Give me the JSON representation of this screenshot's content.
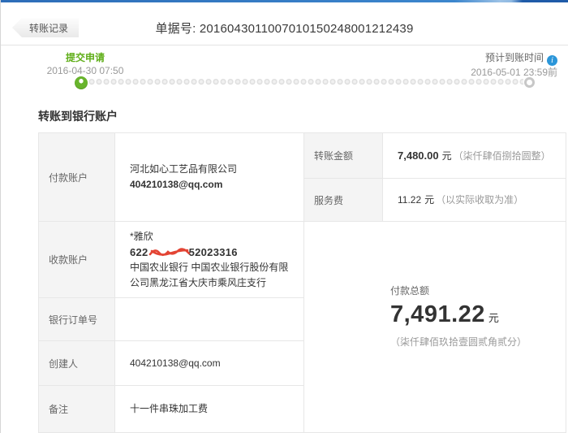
{
  "header": {
    "back_label": "转账记录",
    "doc_label": "单据号: ",
    "doc_number": "2016043011007010150248001212439"
  },
  "timeline": {
    "start": {
      "title": "提交申请",
      "time": "2016-04-30 07:50"
    },
    "end": {
      "title": "预计到账时间",
      "time": "2016-05-01 23:59前",
      "info_glyph": "i"
    }
  },
  "section": {
    "title": "转账到银行账户"
  },
  "fields": {
    "payer": {
      "label": "付款账户",
      "company": "河北如心工艺品有限公司",
      "account": "404210138@qq.com"
    },
    "payee": {
      "label": "收款账户",
      "name": "*雅欣",
      "card_prefix": "622",
      "card_suffix": "52023316",
      "bank": "中国农业银行 中国农业银行股份有限公司黑龙江省大庆市乘风庄支行"
    },
    "bank_order": {
      "label": "银行订单号",
      "value": ""
    },
    "creator": {
      "label": "创建人",
      "value": "404210138@qq.com"
    },
    "remark": {
      "label": "备注",
      "value": "十一件串珠加工费"
    }
  },
  "amounts": {
    "transfer": {
      "label": "转账金额",
      "value": "7,480.00",
      "unit": "元",
      "caps": "（柒仟肆佰捌拾圆整）"
    },
    "fee": {
      "label": "服务费",
      "value": "11.22",
      "unit": "元",
      "note": "（以实际收取为准）"
    },
    "total": {
      "label": "付款总额",
      "value": "7,491.22",
      "unit": "元",
      "caps": "（柒仟肆佰玖拾壹圆贰角贰分）"
    }
  },
  "colors": {
    "accent_green": "#5fae18",
    "info_blue": "#2b96d9",
    "scribble_red": "#e0301e",
    "topbar_blue": "#2e6fba",
    "label_bg": "#f4f4f4",
    "border": "#e7e7e7"
  }
}
